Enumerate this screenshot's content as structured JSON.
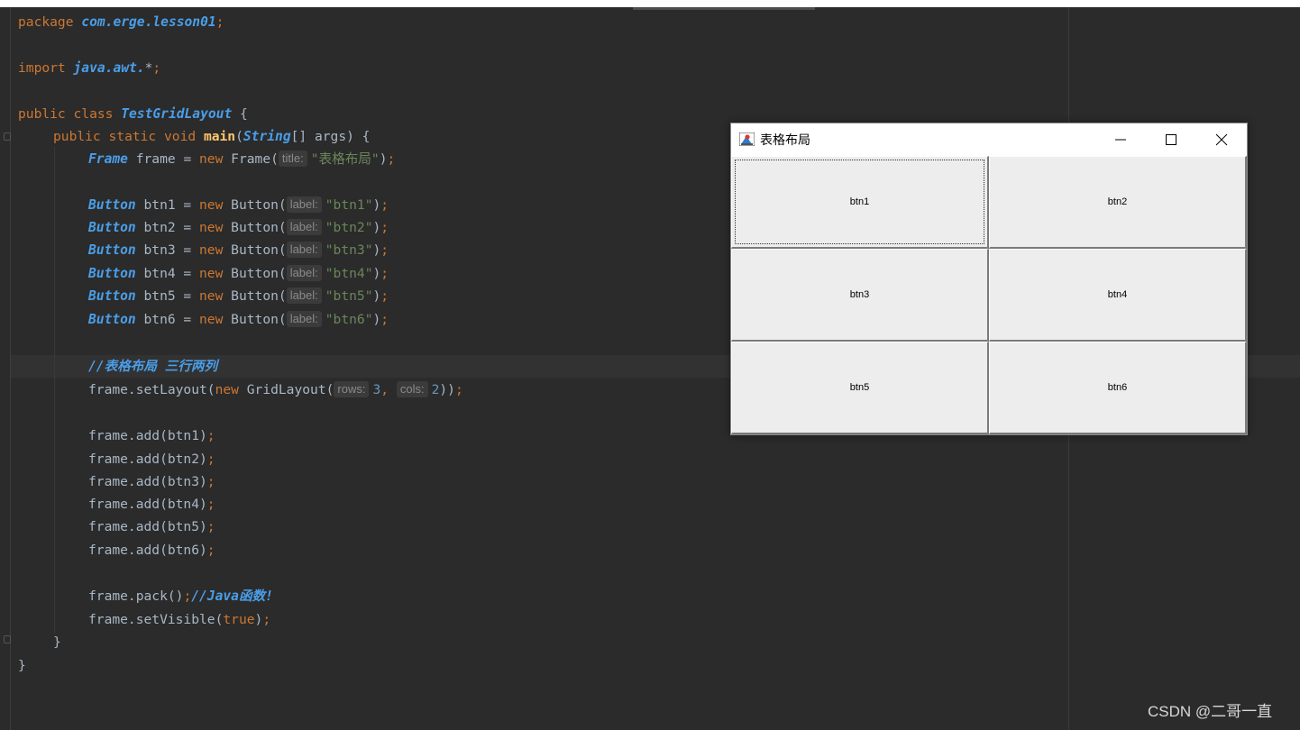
{
  "code": {
    "line1": {
      "kw": "package ",
      "pkg": "com.erge.lesson01",
      "semi": ";"
    },
    "line3": {
      "kw": "import ",
      "pkg": "java.awt.",
      "rest": "*",
      "semi": ";"
    },
    "line5": {
      "kw": "public class ",
      "cls": "TestGridLayout",
      "rest": " {"
    },
    "line6": {
      "kw": "public static void ",
      "fn": "main",
      "p1": "(",
      "type": "String",
      "p2": "[] args) {"
    },
    "line7": {
      "type": "Frame",
      "a": " frame = ",
      "kw": "new ",
      "b": "Frame(",
      "hint": "title:",
      "str": "\"表格布局\"",
      "c": ")",
      "semi": ";"
    },
    "buttons": [
      {
        "type": "Button",
        "a": " btn1 = ",
        "kw": "new ",
        "b": "Button(",
        "hint": "label:",
        "str": "\"btn1\"",
        "c": ")",
        "semi": ";"
      },
      {
        "type": "Button",
        "a": " btn2 = ",
        "kw": "new ",
        "b": "Button(",
        "hint": "label:",
        "str": "\"btn2\"",
        "c": ")",
        "semi": ";"
      },
      {
        "type": "Button",
        "a": " btn3 = ",
        "kw": "new ",
        "b": "Button(",
        "hint": "label:",
        "str": "\"btn3\"",
        "c": ")",
        "semi": ";"
      },
      {
        "type": "Button",
        "a": " btn4 = ",
        "kw": "new ",
        "b": "Button(",
        "hint": "label:",
        "str": "\"btn4\"",
        "c": ")",
        "semi": ";"
      },
      {
        "type": "Button",
        "a": " btn5 = ",
        "kw": "new ",
        "b": "Button(",
        "hint": "label:",
        "str": "\"btn5\"",
        "c": ")",
        "semi": ";"
      },
      {
        "type": "Button",
        "a": " btn6 = ",
        "kw": "new ",
        "b": "Button(",
        "hint": "label:",
        "str": "\"btn6\"",
        "c": ")",
        "semi": ";"
      }
    ],
    "comment1": "//表格布局 三行两列",
    "layout": {
      "a": "frame.setLayout(",
      "kw": "new ",
      "b": "GridLayout(",
      "hint1": "rows:",
      "n1": "3",
      "comma": ", ",
      "hint2": "cols:",
      "n2": "2",
      "c": "))",
      "semi": ";"
    },
    "adds": [
      {
        "a": "frame.add(btn1)",
        "semi": ";"
      },
      {
        "a": "frame.add(btn2)",
        "semi": ";"
      },
      {
        "a": "frame.add(btn3)",
        "semi": ";"
      },
      {
        "a": "frame.add(btn4)",
        "semi": ";"
      },
      {
        "a": "frame.add(btn5)",
        "semi": ";"
      },
      {
        "a": "frame.add(btn6)",
        "semi": ";"
      }
    ],
    "pack": {
      "a": "frame.pack()",
      "semi": ";",
      "cmt": "//Java函数!"
    },
    "visible": {
      "a": "frame.setVisible(",
      "kw": "true",
      "c": ")",
      "semi": ";"
    },
    "close_method": "}",
    "close_class": "}"
  },
  "window": {
    "title": "表格布局",
    "minimize": "—",
    "buttons": [
      "btn1",
      "btn2",
      "btn3",
      "btn4",
      "btn5",
      "btn6"
    ]
  },
  "watermark": "CSDN @二哥一直",
  "colors": {
    "editor_bg": "#2b2b2b",
    "keyword": "#cc7832",
    "type": "#4a9ee8",
    "string": "#6a8759",
    "number": "#6897bb",
    "function": "#ffc66d"
  }
}
